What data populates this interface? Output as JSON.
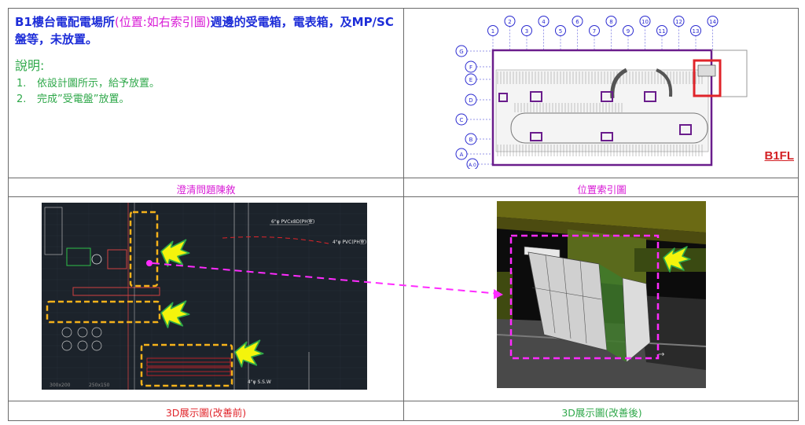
{
  "issue": {
    "title_part1": "B1樓台電配電場所",
    "title_location": "(位置:如右索引圖)",
    "title_part2": "週邊的受電箱，電表箱，及MP/SC盤等，未放置。",
    "notes_heading": "說明:",
    "notes": [
      {
        "num": "1.",
        "text": "依設計圖所示，給予放置。"
      },
      {
        "num": "2.",
        "text": "完成”受電盤”放置。"
      }
    ]
  },
  "captions": {
    "clarification": "澄清問題陳敘",
    "index_map": "位置索引圖",
    "before": "3D展示圖(改善前)",
    "after": "3D展示圖(改善後)"
  },
  "floor_plan": {
    "floor_label": "B1FL",
    "column_grid": [
      "1",
      "2",
      "3",
      "4",
      "5",
      "6",
      "7",
      "8",
      "9",
      "10",
      "11",
      "12",
      "13",
      "14"
    ],
    "row_grid": [
      "G",
      "F",
      "E",
      "D",
      "C",
      "B",
      "A",
      "A.0"
    ]
  },
  "cad_drawing": {
    "labels": [
      "6\"φ PVCx8D(PH室)",
      "4\"φ PVC(PH室)",
      "300x200",
      "250x150",
      "4\"φ S.S.W"
    ]
  },
  "colors": {
    "caption_pink": "#d81bd6",
    "caption_red": "#e0242a",
    "caption_green": "#2fa84a",
    "highlight_orange": "#f5b21b",
    "arrow_yellow": "#f4f40c",
    "dashed_magenta": "#ff2bff",
    "plan_purple": "#6a1d8c"
  }
}
